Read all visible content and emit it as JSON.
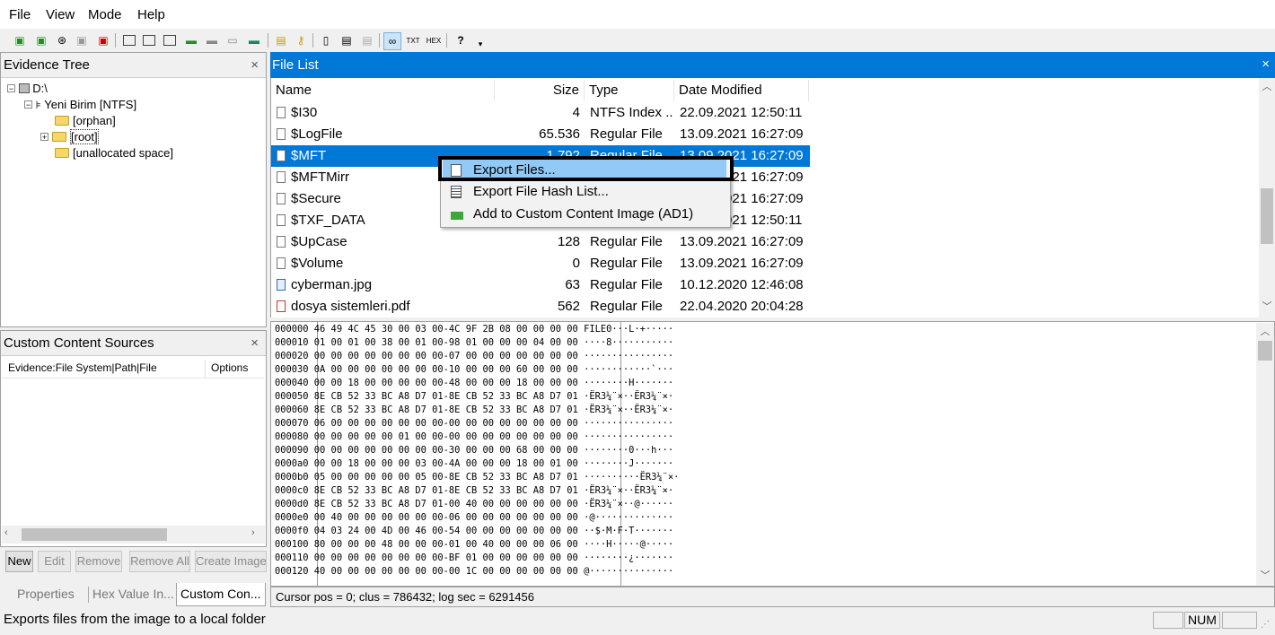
{
  "menu": [
    "File",
    "View",
    "Mode",
    "Help"
  ],
  "evidence_tree": {
    "title": "Evidence Tree",
    "close": "×",
    "items": [
      "D:\\",
      "Yeni Birim [NTFS]",
      "[orphan]",
      "[root]",
      "[unallocated space]"
    ]
  },
  "file_list": {
    "title": "File List",
    "close": "×",
    "columns": [
      "Name",
      "Size",
      "Type",
      "Date Modified"
    ],
    "rows": [
      {
        "name": "$I30",
        "size": "4",
        "type": "NTFS Index ...",
        "date": "22.09.2021 12:50:11"
      },
      {
        "name": "$LogFile",
        "size": "65.536",
        "type": "Regular File",
        "date": "13.09.2021 16:27:09"
      },
      {
        "name": "$MFT",
        "size": "1.792",
        "type": "Regular File",
        "date": "13.09.2021 16:27:09"
      },
      {
        "name": "$MFTMirr",
        "size": "",
        "type": "",
        "date": "13.09.2021 16:27:09"
      },
      {
        "name": "$Secure",
        "size": "",
        "type": "",
        "date": "13.09.2021 16:27:09"
      },
      {
        "name": "$TXF_DATA",
        "size": "",
        "type": "",
        "date": "22.09.2021 12:50:11"
      },
      {
        "name": "$UpCase",
        "size": "128",
        "type": "Regular File",
        "date": "13.09.2021 16:27:09"
      },
      {
        "name": "$Volume",
        "size": "0",
        "type": "Regular File",
        "date": "13.09.2021 16:27:09"
      },
      {
        "name": "cyberman.jpg",
        "size": "63",
        "type": "Regular File",
        "date": "10.12.2020 12:46:08"
      },
      {
        "name": "dosya sistemleri.pdf",
        "size": "562",
        "type": "Regular File",
        "date": "22.04.2020 20:04:28"
      }
    ]
  },
  "context_menu": {
    "items": [
      "Export Files...",
      "Export File Hash List...",
      "Add to Custom Content Image (AD1)"
    ]
  },
  "custom_content": {
    "title": "Custom Content Sources",
    "close": "×",
    "columns": [
      "Evidence:File System|Path|File",
      "Options"
    ],
    "buttons": [
      "New",
      "Edit",
      "Remove",
      "Remove All",
      "Create Image"
    ]
  },
  "bottom_tabs": [
    "Properties",
    "Hex Value In...",
    "Custom Con..."
  ],
  "hex": {
    "lines": [
      "000000 46 49 4C 45 30 00 03 00-4C 9F 2B 08 00 00 00 00 FILE0···L·+·····",
      "000010 01 00 01 00 38 00 01 00-98 01 00 00 00 04 00 00 ····8···········",
      "000020 00 00 00 00 00 00 00 00-07 00 00 00 00 00 00 00 ················",
      "000030 0A 00 00 00 00 00 00 00-10 00 00 00 60 00 00 00 ············`···",
      "000040 00 00 18 00 00 00 00 00-48 00 00 00 18 00 00 00 ········H·······",
      "000050 8E CB 52 33 BC A8 D7 01-8E CB 52 33 BC A8 D7 01 ·ËR3¼¨×··ËR3¼¨×·",
      "000060 8E CB 52 33 BC A8 D7 01-8E CB 52 33 BC A8 D7 01 ·ËR3¼¨×··ËR3¼¨×·",
      "000070 06 00 00 00 00 00 00 00-00 00 00 00 00 00 00 00 ················",
      "000080 00 00 00 00 00 01 00 00-00 00 00 00 00 00 00 00 ················",
      "000090 00 00 00 00 00 00 00 00-30 00 00 00 68 00 00 00 ········0···h···",
      "0000a0 00 00 18 00 00 00 03 00-4A 00 00 00 18 00 01 00 ········J·······",
      "0000b0 05 00 00 00 00 00 05 00-8E CB 52 33 BC A8 D7 01 ··········ËR3¼¨×·",
      "0000c0 8E CB 52 33 BC A8 D7 01-8E CB 52 33 BC A8 D7 01 ·ËR3¼¨×··ËR3¼¨×·",
      "0000d0 8E CB 52 33 BC A8 D7 01-00 40 00 00 00 00 00 00 ·ËR3¼¨×··@······",
      "0000e0 00 40 00 00 00 00 00 00-06 00 00 00 00 00 00 00 ·@··············",
      "0000f0 04 03 24 00 4D 00 46 00-54 00 00 00 00 00 00 00 ··$·M·F·T·······",
      "000100 80 00 00 00 48 00 00 00-01 00 40 00 00 00 06 00 ····H·····@·····",
      "000110 00 00 00 00 00 00 00 00-BF 01 00 00 00 00 00 00 ········¿·······",
      "000120 40 00 00 00 00 00 00 00-00 1C 00 00 00 00 00 00 @···············"
    ],
    "cursor": "Cursor pos = 0; clus = 786432; log sec = 6291456"
  },
  "status": {
    "text": "Exports files from the image to a local folder",
    "num": "NUM"
  }
}
